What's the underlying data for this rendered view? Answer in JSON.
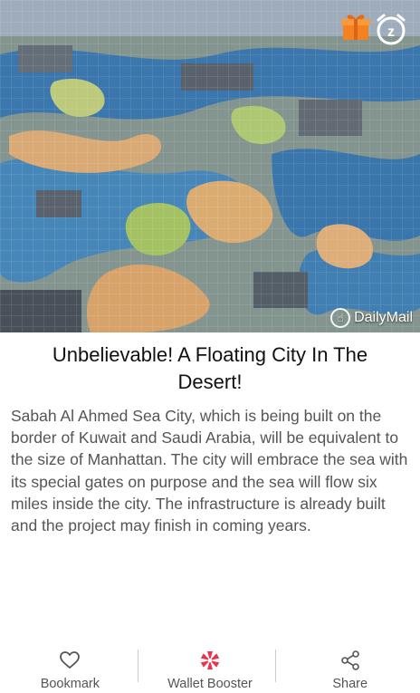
{
  "hero": {
    "source_name": "DailyMail",
    "gift_icon": "gift-icon",
    "snooze_icon": "snooze-icon",
    "snooze_letter": "z"
  },
  "article": {
    "title": "Unbelievable! A Floating City In The Desert!",
    "body": "Sabah Al Ahmed Sea City, which is being built on the border of Kuwait and Saudi Arabia, will be equivalent to the size of Manhattan. The city will embrace the sea with its special gates on purpose and the sea will flow six miles inside the city. The infrastructure is already built and the project may finish in coming years."
  },
  "bottom_bar": {
    "bookmark_label": "Bookmark",
    "wallet_label": "Wallet Booster",
    "share_label": "Share"
  },
  "colors": {
    "gift_orange": "#f5821f",
    "wallet_red": "#e8344e",
    "text_dark": "#111111",
    "text_body": "#555555"
  }
}
